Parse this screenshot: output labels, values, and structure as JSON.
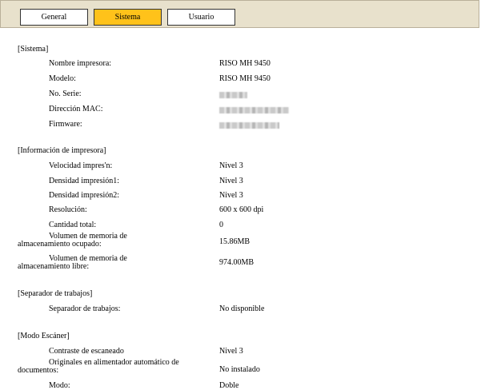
{
  "tabs": [
    {
      "label": "General",
      "active": false
    },
    {
      "label": "Sistema",
      "active": true
    },
    {
      "label": "Usuario",
      "active": false
    }
  ],
  "sections": {
    "sistema": {
      "title": "[Sistema]",
      "rows": {
        "nombre": {
          "label": "Nombre impresora:",
          "value": "RISO MH 9450"
        },
        "modelo": {
          "label": "Modelo:",
          "value": "RISO MH 9450"
        },
        "serie": {
          "label": "No. Serie:"
        },
        "mac": {
          "label": "Dirección MAC:"
        },
        "firmware": {
          "label": "Firmware:"
        }
      }
    },
    "impresora": {
      "title": "[Información de impresora]",
      "rows": {
        "velocidad": {
          "label": "Velocidad impres'n:",
          "value": "Nivel 3"
        },
        "densidad1": {
          "label": "Densidad impresión1:",
          "value": "Nivel 3"
        },
        "densidad2": {
          "label": "Densidad impresión2:",
          "value": "Nivel 3"
        },
        "resolucion": {
          "label": "Resolución:",
          "value": "600 x 600 dpi"
        },
        "cantidad": {
          "label": "Cantidad total:",
          "value": "0"
        },
        "mem_ocupado": {
          "label1": "Volumen de memoria de",
          "label2": "almacenamiento ocupado:",
          "value": "15.86MB"
        },
        "mem_libre": {
          "label1": "Volumen de memoria de",
          "label2": "almacenamiento libre:",
          "value": "974.00MB"
        }
      }
    },
    "separador": {
      "title": "[Separador de trabajos]",
      "rows": {
        "separador": {
          "label": "Separador de trabajos:",
          "value": "No disponible"
        }
      }
    },
    "escaner": {
      "title": "[Modo Escáner]",
      "rows": {
        "contraste": {
          "label": "Contraste de escaneado",
          "value": "Nivel 3"
        },
        "originales": {
          "label1": "Originales en alimentador automático de",
          "label2": "documentos:",
          "value": "No instalado"
        },
        "modo": {
          "label": "Modo:",
          "value": "Doble"
        }
      }
    }
  }
}
